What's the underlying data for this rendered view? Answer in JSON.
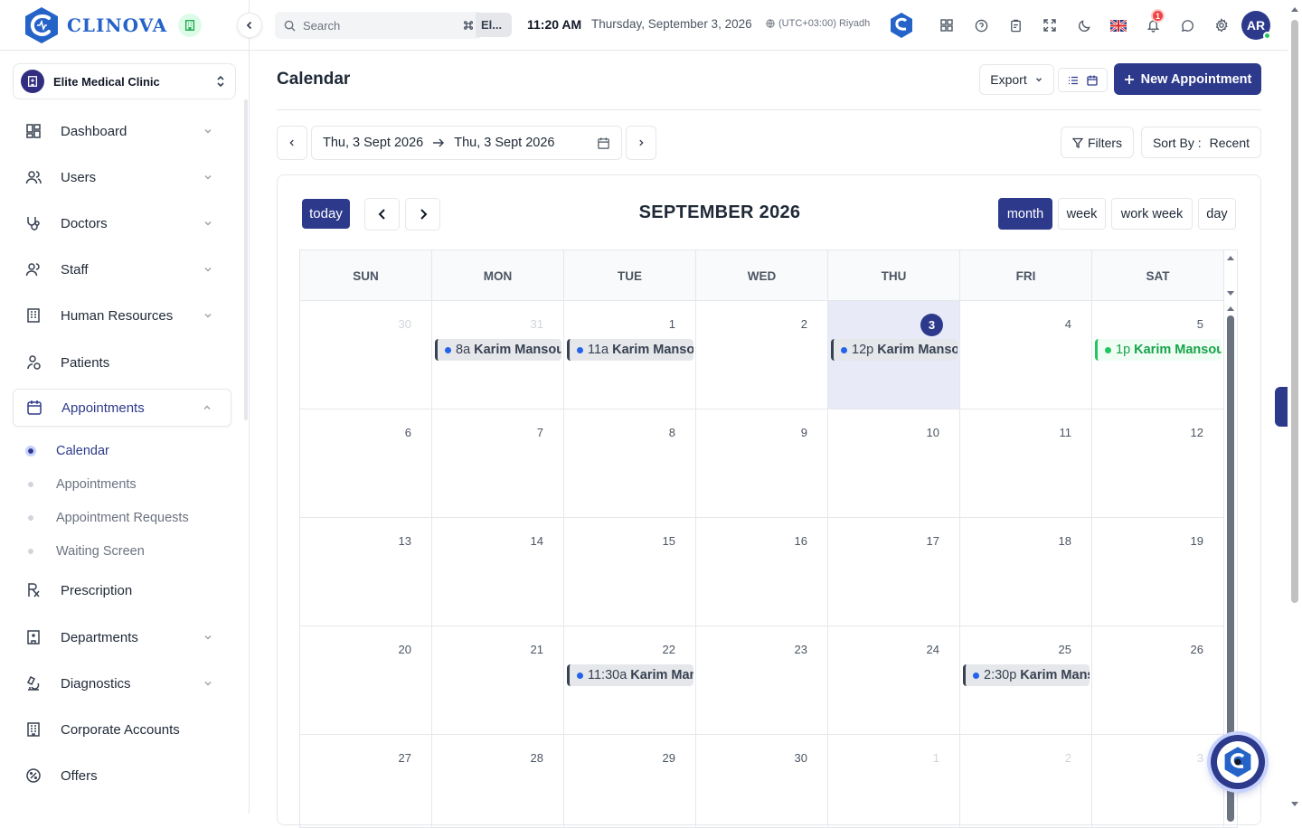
{
  "brand": {
    "name": "CLINOVA"
  },
  "clinic": {
    "name": "Elite Medical Clinic"
  },
  "header": {
    "search_placeholder": "Search",
    "search_overflow": "El...",
    "time": "11:20 AM",
    "date": "Thursday, September 3, 2026",
    "timezone": "(UTC+03:00) Riyadh",
    "notification_count": "1",
    "avatar_initials": "AR"
  },
  "sidebar": {
    "items": [
      {
        "label": "Dashboard"
      },
      {
        "label": "Users"
      },
      {
        "label": "Doctors"
      },
      {
        "label": "Staff"
      },
      {
        "label": "Human Resources"
      },
      {
        "label": "Patients"
      },
      {
        "label": "Appointments"
      },
      {
        "label": "Prescription"
      },
      {
        "label": "Departments"
      },
      {
        "label": "Diagnostics"
      },
      {
        "label": "Corporate Accounts"
      },
      {
        "label": "Offers"
      }
    ],
    "subitems": [
      {
        "label": "Calendar"
      },
      {
        "label": "Appointments"
      },
      {
        "label": "Appointment Requests"
      },
      {
        "label": "Waiting Screen"
      }
    ]
  },
  "page": {
    "title": "Calendar",
    "export_label": "Export",
    "new_appointment_label": "New Appointment",
    "range_start": "Thu, 3 Sept 2026",
    "range_end": "Thu, 3 Sept 2026",
    "filters_label": "Filters",
    "sort_prefix": "Sort By :",
    "sort_value": "Recent"
  },
  "calendar": {
    "today_label": "today",
    "title": "SEPTEMBER 2026",
    "views": [
      "month",
      "week",
      "work week",
      "day"
    ],
    "active_view": "month",
    "weekdays": [
      "SUN",
      "MON",
      "TUE",
      "WED",
      "THU",
      "FRI",
      "SAT"
    ],
    "weeks": [
      [
        {
          "d": "30",
          "muted": true
        },
        {
          "d": "31",
          "muted": true
        },
        {
          "d": "1"
        },
        {
          "d": "2"
        },
        {
          "d": "3",
          "today": true
        },
        {
          "d": "4"
        },
        {
          "d": "5"
        }
      ],
      [
        {
          "d": "6"
        },
        {
          "d": "7"
        },
        {
          "d": "8"
        },
        {
          "d": "9"
        },
        {
          "d": "10"
        },
        {
          "d": "11"
        },
        {
          "d": "12"
        }
      ],
      [
        {
          "d": "13"
        },
        {
          "d": "14"
        },
        {
          "d": "15"
        },
        {
          "d": "16"
        },
        {
          "d": "17"
        },
        {
          "d": "18"
        },
        {
          "d": "19"
        }
      ],
      [
        {
          "d": "20"
        },
        {
          "d": "21"
        },
        {
          "d": "22"
        },
        {
          "d": "23"
        },
        {
          "d": "24"
        },
        {
          "d": "25"
        },
        {
          "d": "26"
        }
      ],
      [
        {
          "d": "27"
        },
        {
          "d": "28"
        },
        {
          "d": "29"
        },
        {
          "d": "30"
        },
        {
          "d": "1",
          "muted": true
        },
        {
          "d": "2",
          "muted": true
        },
        {
          "d": "3",
          "muted": true
        }
      ]
    ],
    "events": [
      {
        "week": 0,
        "day": 1,
        "time": "8a",
        "name": "Karim Mansour",
        "color": "default"
      },
      {
        "week": 0,
        "day": 2,
        "time": "11a",
        "name": "Karim Mansour",
        "color": "default"
      },
      {
        "week": 0,
        "day": 4,
        "time": "12p",
        "name": "Karim Mansour",
        "color": "default"
      },
      {
        "week": 0,
        "day": 6,
        "time": "1p",
        "name": "Karim Mansour",
        "color": "green"
      },
      {
        "week": 3,
        "day": 2,
        "time": "11:30a",
        "name": "Karim Mansour",
        "color": "default"
      },
      {
        "week": 3,
        "day": 5,
        "time": "2:30p",
        "name": "Karim Mansour",
        "color": "default"
      }
    ]
  },
  "colors": {
    "primary": "#2d3a8c",
    "event_dot": "#2563eb",
    "event_green": "#22c55e",
    "badge": "#ef4444"
  }
}
